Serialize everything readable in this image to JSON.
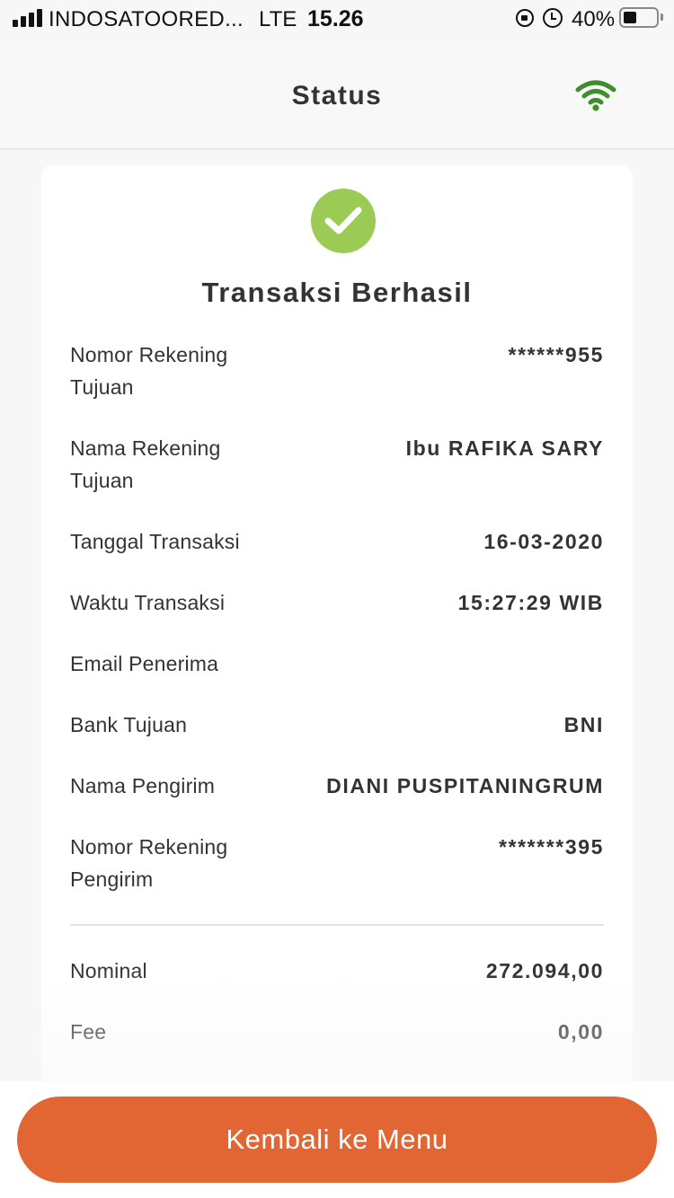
{
  "status_bar": {
    "carrier": "INDOSATOORED...",
    "network": "LTE",
    "time": "15.26",
    "battery": "40%",
    "battery_level": 0.4
  },
  "header": {
    "title": "Status",
    "connection_icon": "wifi-icon",
    "connection_color": "#3e8e2f"
  },
  "result": {
    "icon": "check-icon",
    "icon_color": "#9ccb55",
    "title": "Transaksi Berhasil"
  },
  "details": [
    {
      "label": "Nomor Rekening Tujuan",
      "value": "******955"
    },
    {
      "label": "Nama Rekening Tujuan",
      "value": "Ibu RAFIKA SARY"
    },
    {
      "label": "Tanggal Transaksi",
      "value": "16-03-2020"
    },
    {
      "label": "Waktu Transaksi",
      "value": "15:27:29 WIB"
    },
    {
      "label": "Email Penerima",
      "value": ""
    },
    {
      "label": "Bank Tujuan",
      "value": "BNI"
    },
    {
      "label": "Nama Pengirim",
      "value": "DIANI PUSPITANINGRUM"
    },
    {
      "label": "Nomor Rekening Pengirim",
      "value": "*******395"
    }
  ],
  "amounts": [
    {
      "label": "Nominal",
      "value": "272.094,00"
    },
    {
      "label": "Fee",
      "value": "0,00"
    }
  ],
  "footer": {
    "button_label": "Kembali ke Menu",
    "button_color": "#e26534"
  }
}
